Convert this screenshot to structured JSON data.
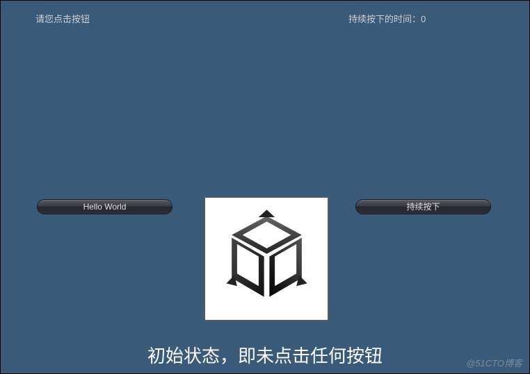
{
  "top": {
    "prompt_label": "请您点击按钮",
    "hold_time_label": "持续按下的时间：0"
  },
  "buttons": {
    "hello_world": "Hello World",
    "hold_down": "持续按下"
  },
  "logo": {
    "name": "unity-logo"
  },
  "caption": "初始状态，即未点击任何按钮",
  "watermark": "@51CTO博客"
}
